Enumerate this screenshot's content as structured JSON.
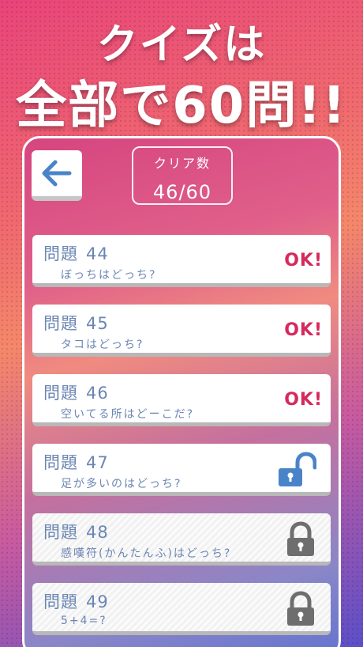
{
  "headline": {
    "line1": "クイズは",
    "line2": "全部で60問!!"
  },
  "header": {
    "back_icon": "arrow-left-icon",
    "score_label": "クリア数",
    "score_value": "46/60"
  },
  "questions": [
    {
      "label": "問題",
      "number": "44",
      "text": "ぼっちはどっち?",
      "status": "OK!"
    },
    {
      "label": "問題",
      "number": "45",
      "text": "タコはどっち?",
      "status": "OK!"
    },
    {
      "label": "問題",
      "number": "46",
      "text": "空いてる所はどーこだ?",
      "status": "OK!"
    },
    {
      "label": "問題",
      "number": "47",
      "text": "足が多いのはどっち?",
      "status": "unlocked"
    },
    {
      "label": "問題",
      "number": "48",
      "text": "感嘆符(かんたんふ)はどっち?",
      "status": "locked"
    },
    {
      "label": "問題",
      "number": "49",
      "text": "5+4=?",
      "status": "locked"
    }
  ],
  "colors": {
    "accent_ok": "#d62a5c",
    "text_blue": "#6b86b3",
    "unlock_icon": "#4a84c8",
    "lock_icon": "#6e6e6e"
  }
}
